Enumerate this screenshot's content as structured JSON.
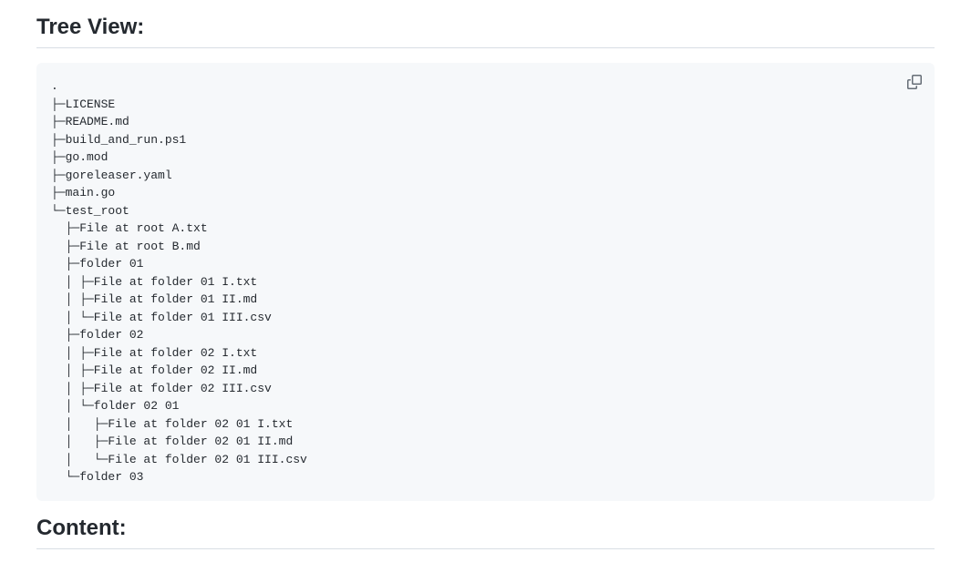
{
  "headings": {
    "tree_view": "Tree View:",
    "content": "Content:"
  },
  "tree_lines": [
    ".",
    "├─LICENSE",
    "├─README.md",
    "├─build_and_run.ps1",
    "├─go.mod",
    "├─goreleaser.yaml",
    "├─main.go",
    "└─test_root",
    "  ├─File at root A.txt",
    "  ├─File at root B.md",
    "  ├─folder 01",
    "  │ ├─File at folder 01 I.txt",
    "  │ ├─File at folder 01 II.md",
    "  │ └─File at folder 01 III.csv",
    "  ├─folder 02",
    "  │ ├─File at folder 02 I.txt",
    "  │ ├─File at folder 02 II.md",
    "  │ ├─File at folder 02 III.csv",
    "  │ └─folder 02 01",
    "  │   ├─File at folder 02 01 I.txt",
    "  │   ├─File at folder 02 01 II.md",
    "  │   └─File at folder 02 01 III.csv",
    "  └─folder 03"
  ]
}
